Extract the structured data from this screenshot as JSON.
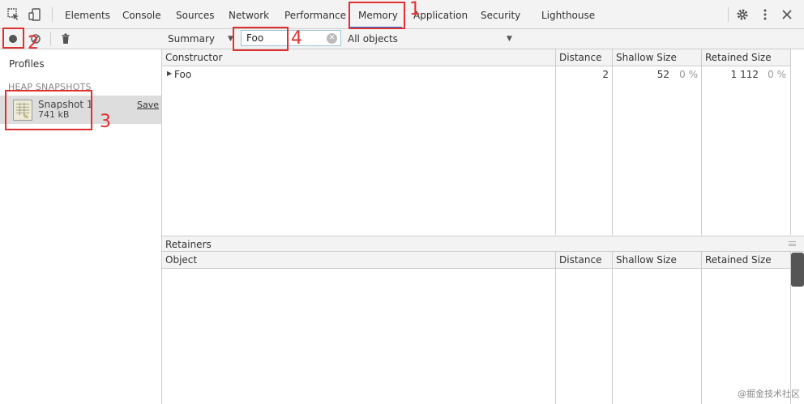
{
  "tabs": [
    {
      "label": "Elements"
    },
    {
      "label": "Console"
    },
    {
      "label": "Sources"
    },
    {
      "label": "Network"
    },
    {
      "label": "Performance"
    },
    {
      "label": "Memory"
    },
    {
      "label": "Application"
    },
    {
      "label": "Security"
    },
    {
      "label": "Lighthouse"
    }
  ],
  "active_tab": "Memory",
  "toolbar": {
    "view_select": "Summary",
    "filter_value": "Foo",
    "objects_select": "All objects"
  },
  "sidebar": {
    "profiles_label": "Profiles",
    "section_header": "HEAP SNAPSHOTS",
    "snapshot": {
      "title": "Snapshot 1",
      "size": "741 kB",
      "save_label": "Save"
    }
  },
  "summary_grid": {
    "headers": {
      "constructor": "Constructor",
      "distance": "Distance",
      "shallow": "Shallow Size",
      "retained": "Retained Size"
    },
    "rows": [
      {
        "name": "Foo",
        "distance": "2",
        "shallow": "52",
        "shallow_pct": "0 %",
        "retained": "1 112",
        "retained_pct": "0 %"
      }
    ]
  },
  "retainers": {
    "label": "Retainers",
    "headers": {
      "object": "Object",
      "distance": "Distance",
      "shallow": "Shallow Size",
      "retained": "Retained Size"
    }
  },
  "annotations": [
    "1",
    "2",
    "3",
    "4"
  ],
  "watermark": "@掘金技术社区",
  "colors": {
    "annotation": "#e03030",
    "accent": "#1a73e8"
  }
}
